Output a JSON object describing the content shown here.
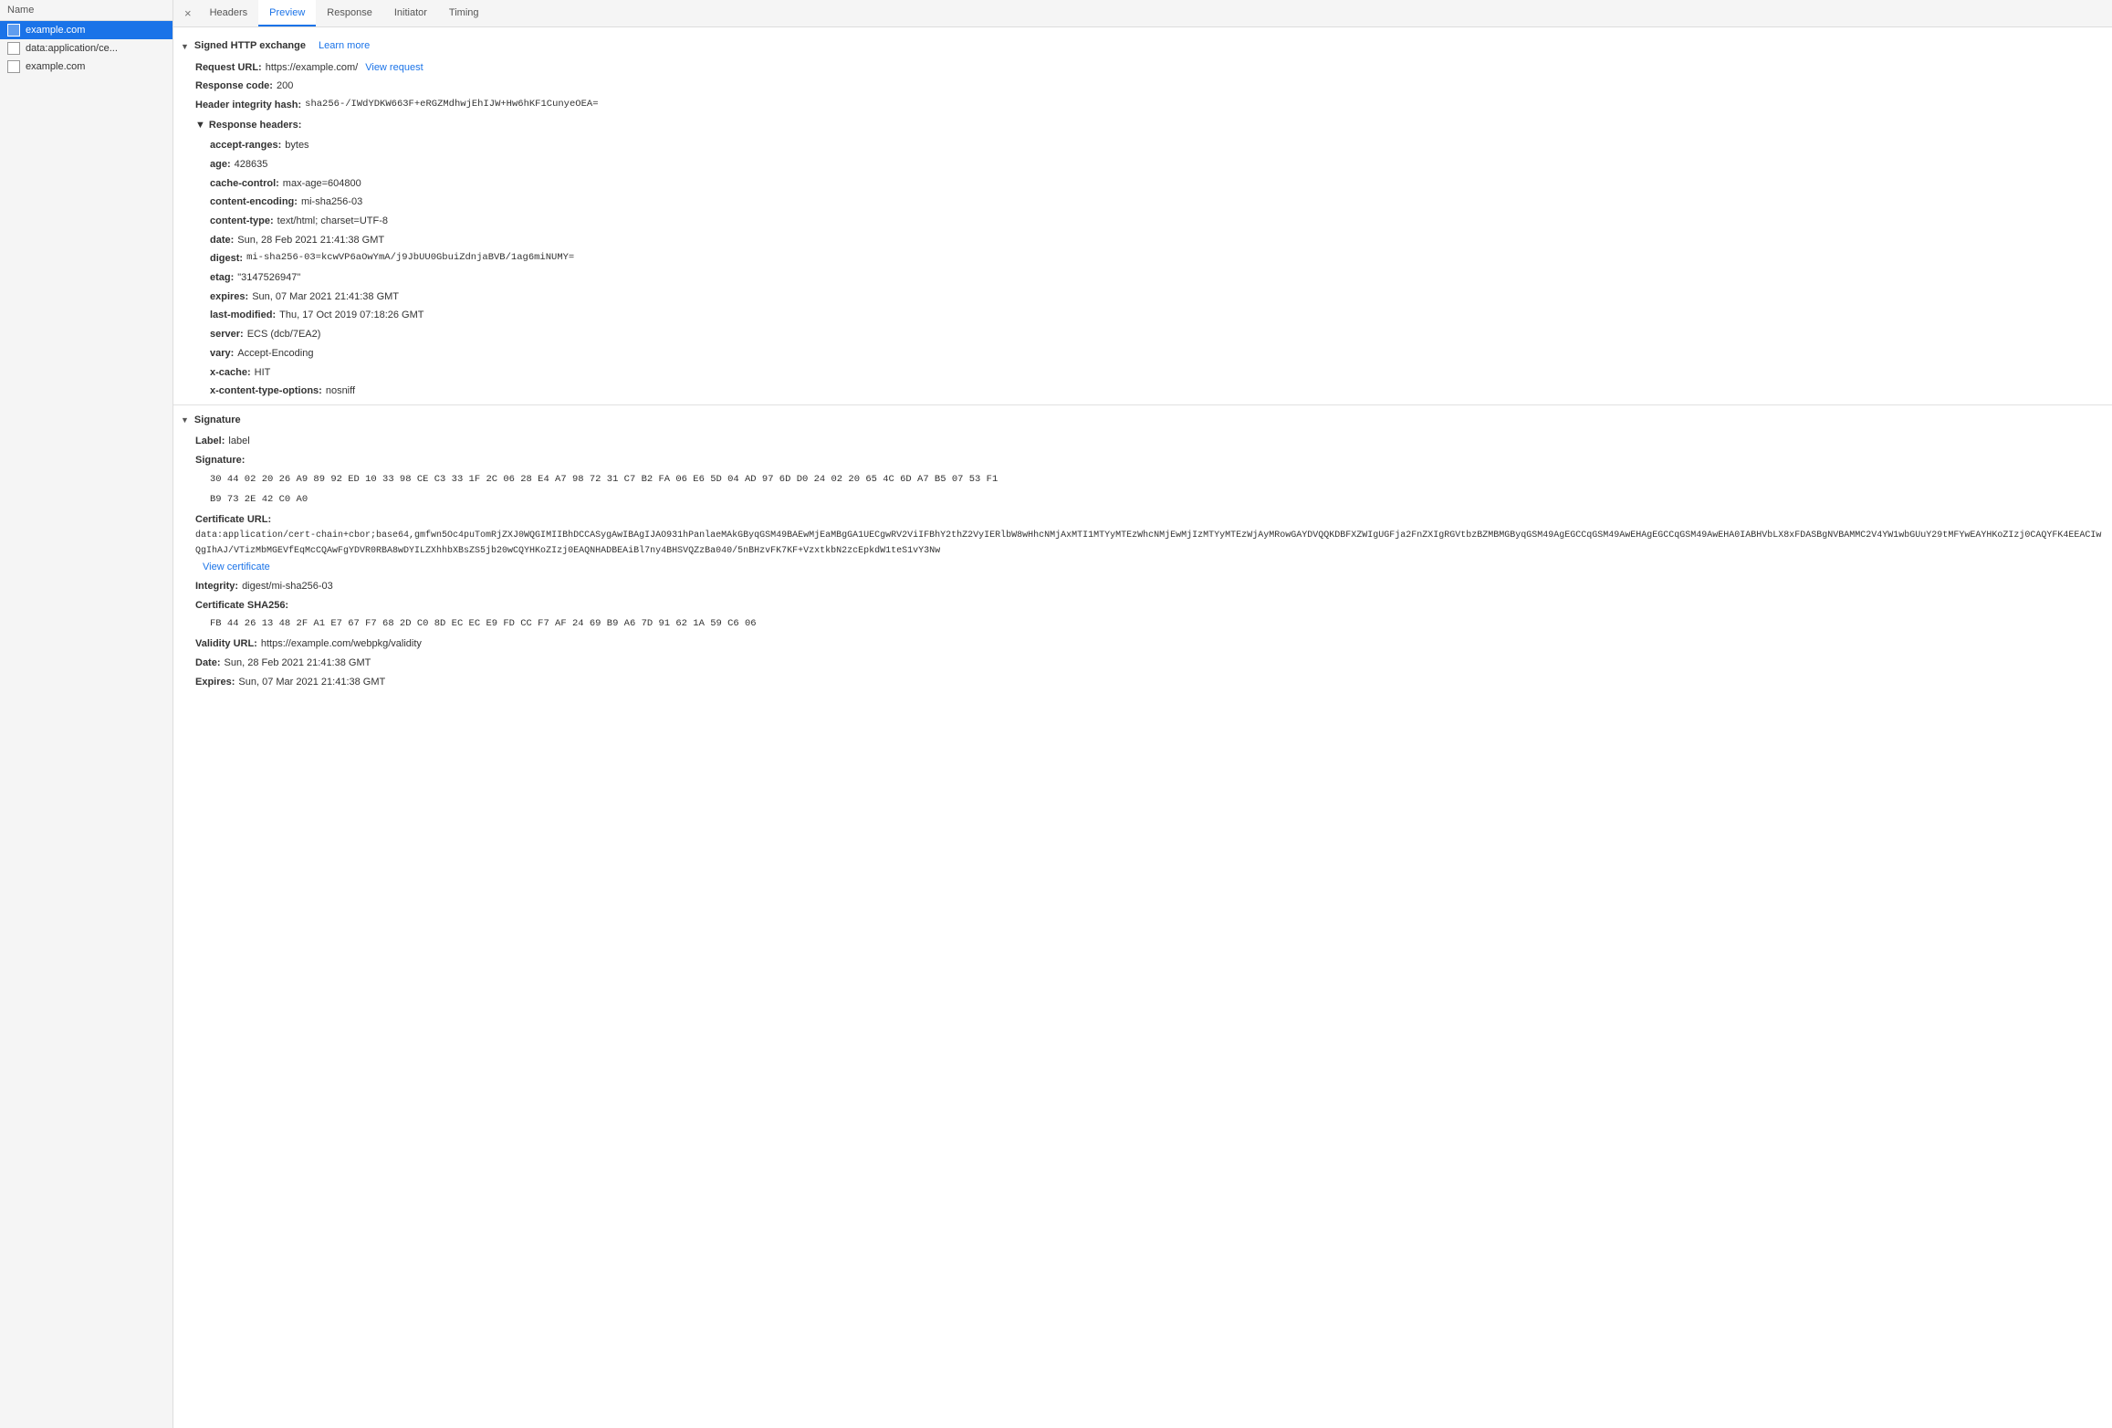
{
  "sidebar": {
    "header": "Name",
    "items": [
      {
        "id": "example-com-1",
        "label": "example.com",
        "active": true
      },
      {
        "id": "data-application",
        "label": "data:application/ce...",
        "active": false
      },
      {
        "id": "example-com-2",
        "label": "example.com",
        "active": false
      }
    ]
  },
  "tabs": {
    "close_label": "×",
    "items": [
      {
        "id": "headers",
        "label": "Headers",
        "active": false
      },
      {
        "id": "preview",
        "label": "Preview",
        "active": true
      },
      {
        "id": "response",
        "label": "Response",
        "active": false
      },
      {
        "id": "initiator",
        "label": "Initiator",
        "active": false
      },
      {
        "id": "timing",
        "label": "Timing",
        "active": false
      }
    ]
  },
  "content": {
    "signed_http_exchange": {
      "section_title": "Signed HTTP exchange",
      "learn_more": "Learn more",
      "triangle": "▼",
      "request_url_label": "Request URL:",
      "request_url_value": "https://example.com/",
      "view_request_label": "View request",
      "response_code_label": "Response code:",
      "response_code_value": "200",
      "header_integrity_label": "Header integrity hash:",
      "header_integrity_value": "sha256-/IWdYDKW663F+eRGZMdhwjEhIJW+Hw6hKF1CunyeOEA=",
      "response_headers": {
        "triangle": "▼",
        "title": "Response headers:",
        "rows": [
          {
            "key": "accept-ranges:",
            "value": "bytes"
          },
          {
            "key": "age:",
            "value": "428635"
          },
          {
            "key": "cache-control:",
            "value": "max-age=604800"
          },
          {
            "key": "content-encoding:",
            "value": "mi-sha256-03"
          },
          {
            "key": "content-type:",
            "value": "text/html; charset=UTF-8"
          },
          {
            "key": "date:",
            "value": "Sun, 28 Feb 2021 21:41:38 GMT"
          },
          {
            "key": "digest:",
            "value": "mi-sha256-03=kcwVP6aOwYmA/j9JbUU0GbuiZdnjaBVB/1ag6miNUMY="
          },
          {
            "key": "etag:",
            "value": "\"3147526947\""
          },
          {
            "key": "expires:",
            "value": "Sun, 07 Mar 2021 21:41:38 GMT"
          },
          {
            "key": "last-modified:",
            "value": "Thu, 17 Oct 2019 07:18:26 GMT"
          },
          {
            "key": "server:",
            "value": "ECS (dcb/7EA2)"
          },
          {
            "key": "vary:",
            "value": "Accept-Encoding"
          },
          {
            "key": "x-cache:",
            "value": "HIT"
          },
          {
            "key": "x-content-type-options:",
            "value": "nosniff"
          }
        ]
      }
    },
    "signature": {
      "triangle": "▼",
      "title": "Signature",
      "label_label": "Label:",
      "label_value": "label",
      "signature_label": "Signature:",
      "signature_line1": "30 44 02 20 26 A9 89 92 ED 10 33 98 CE C3 33 1F 2C 06 28 E4 A7 98 72 31 C7 B2 FA 06 E6 5D 04 AD 97 6D D0 24 02 20 65 4C 6D A7 B5 07 53 F1",
      "signature_line2": "B9 73 2E 42 C0 A0",
      "cert_url_label": "Certificate URL:",
      "cert_url_value": "data:application/cert-chain+cbor;base64,gmfwn5Oc4puTomRjZXJ0WQGIMIIBhDCCASygAwIBAgIJAO931hPanlaeMAkGByqGSM49BAEwMjEaMBgGA1UECgwRV2ViIFBhY2thZ2VyIERlbW8wHhcNMjAxMTI1MTYyMTEzWhcNMjEwMjIzMTYyMTEzWjAyMRowGAYDVQQKDBFXZWIgUGFja2FnZXIgRGVtbzBZMBMGByqGSM49AgEGCCqGSM49AwEHAgEGCCqGSM49AwEHA0IABHVbLX8xFDASBgNVBAMMC2V4YW1wbGUuY29tMFYwEAYHKoZIzj0CAQYFK4EEACIwQgIhAJ/VTizMbMGEVfEqMcCQAwFgYDVR0RBA8wDYILZXhhbXBsZS5jb20wCQYHKoZIzj0EAQNHADBEAiBl7ny4BHSVQZzBa040/5nBHzvFK7KF+VzxtkbN2zcEpkdW1teS1vY3Nw",
      "view_certificate_label": "View certificate",
      "integrity_label": "Integrity:",
      "integrity_value": "digest/mi-sha256-03",
      "cert_sha256_label": "Certificate SHA256:",
      "cert_sha256_value": "FB 44 26 13 48 2F A1 E7 67 F7 68 2D C0 8D EC EC E9 FD CC F7 AF 24 69 B9 A6 7D 91 62 1A 59 C6 06",
      "validity_url_label": "Validity URL:",
      "validity_url_value": "https://example.com/webpkg/validity",
      "date_label": "Date:",
      "date_value": "Sun, 28 Feb 2021 21:41:38 GMT",
      "expires_label": "Expires:",
      "expires_value": "Sun, 07 Mar 2021 21:41:38 GMT"
    }
  },
  "colors": {
    "active_tab": "#1a73e8",
    "active_sidebar": "#1a73e8",
    "link_color": "#1a73e8"
  }
}
